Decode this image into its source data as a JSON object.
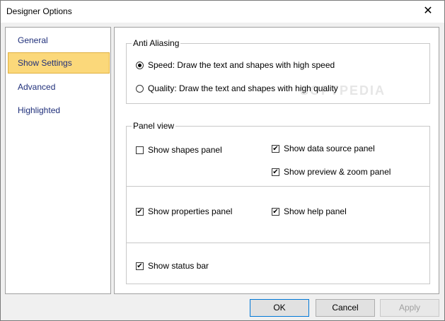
{
  "window": {
    "title": "Designer Options",
    "close_glyph": "✕"
  },
  "sidebar": {
    "items": [
      {
        "label": "General"
      },
      {
        "label": "Show Settings",
        "selected": true
      },
      {
        "label": "Advanced"
      },
      {
        "label": "Highlighted"
      }
    ]
  },
  "anti_aliasing": {
    "title": "Anti Aliasing",
    "options": [
      {
        "label": "Speed: Draw the text and shapes with high speed",
        "selected": true
      },
      {
        "label": "Quality: Draw the text and shapes with high quality",
        "selected": false
      }
    ]
  },
  "panel_view": {
    "title": "Panel view",
    "show_shapes_panel": {
      "label": "Show shapes panel",
      "checked": false
    },
    "show_data_source_panel": {
      "label": "Show data source panel",
      "checked": true
    },
    "show_preview_zoom_panel": {
      "label": "Show preview & zoom panel",
      "checked": true
    },
    "show_properties_panel": {
      "label": "Show properties panel",
      "checked": true
    },
    "show_help_panel": {
      "label": "Show help panel",
      "checked": true
    },
    "show_status_bar": {
      "label": "Show status bar",
      "checked": true
    }
  },
  "watermark": "SOFTPEDIA",
  "buttons": {
    "ok": "OK",
    "cancel": "Cancel",
    "apply": "Apply"
  },
  "colors": {
    "selection": "#fbd87a",
    "nav_text": "#1f2f7a",
    "default_border": "#0078d7"
  }
}
